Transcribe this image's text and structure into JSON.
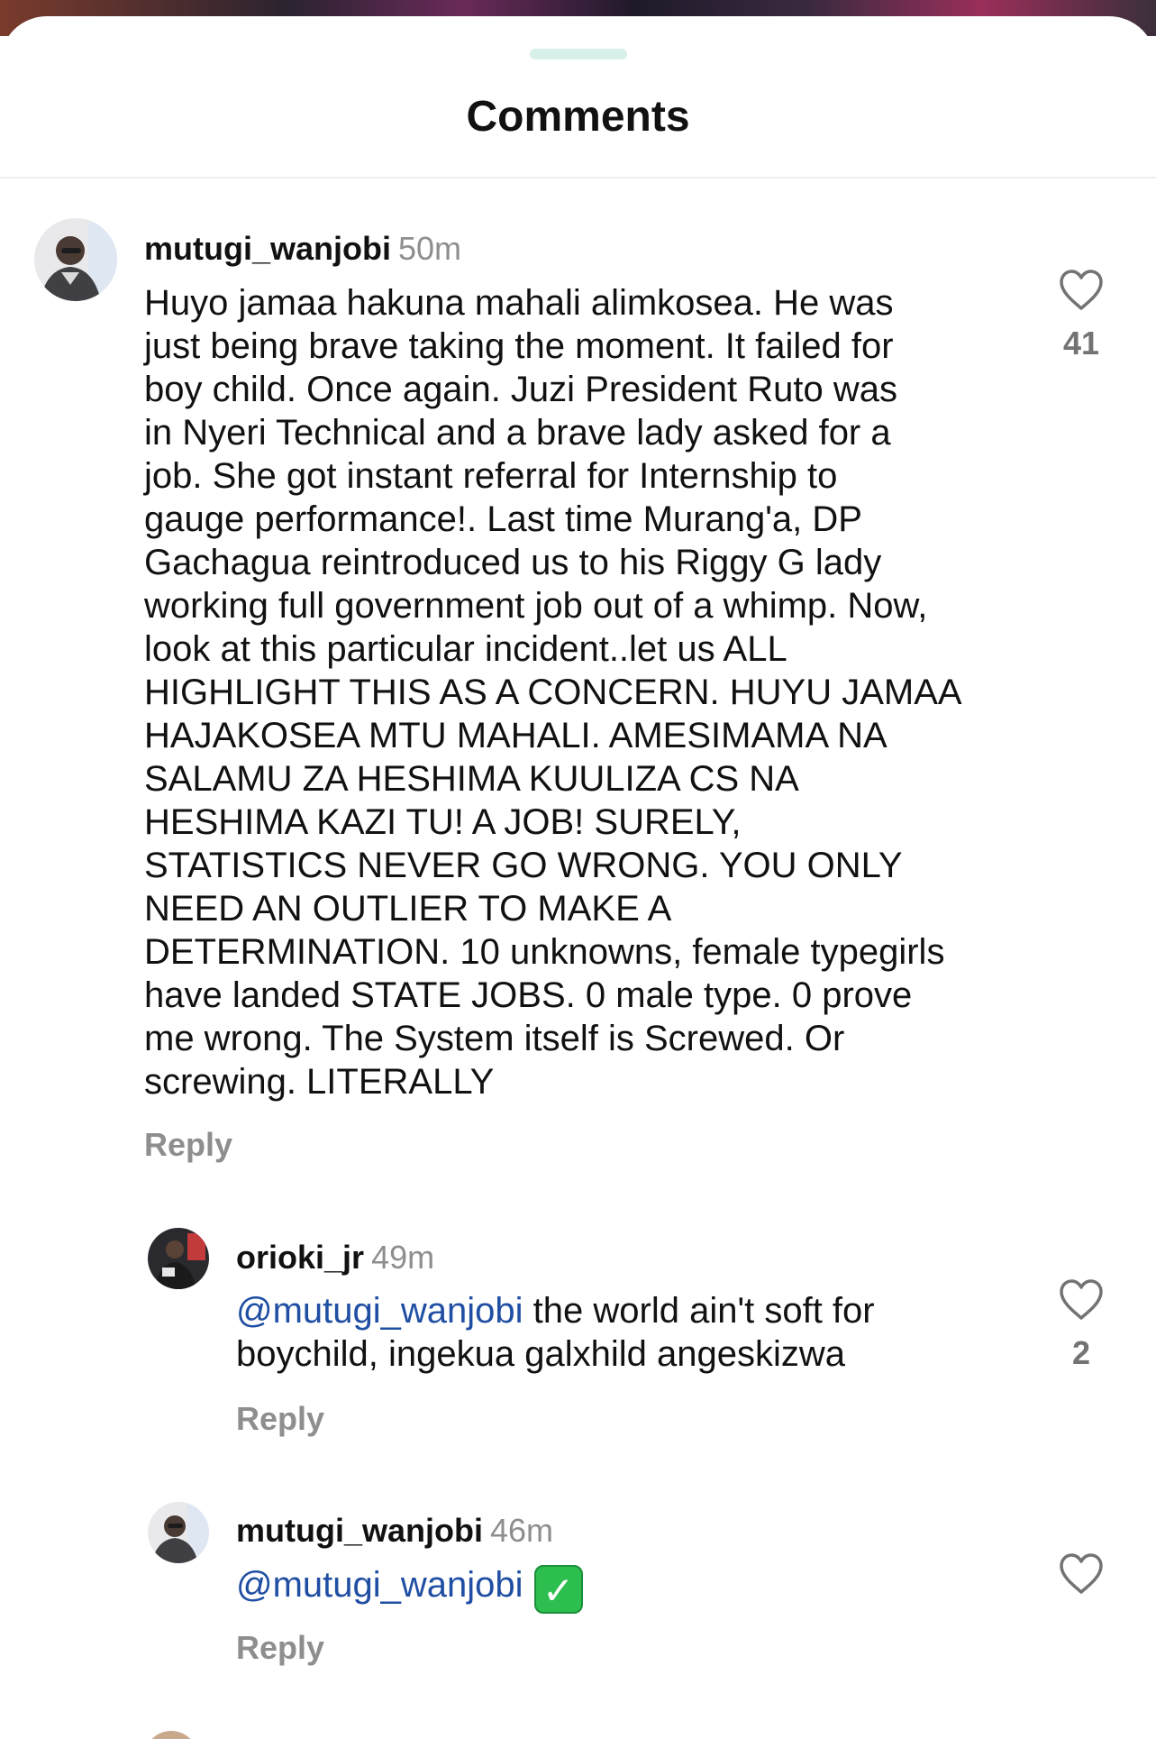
{
  "sheet": {
    "title": "Comments"
  },
  "comments": [
    {
      "username": "mutugi_wanjobi",
      "time": "50m",
      "text": "Huyo jamaa hakuna mahali alimkosea. He was\njust being brave taking the moment.  It failed for\nboy child. Once again.  Juzi President Ruto was\nin Nyeri Technical and a brave lady asked for a\njob. She got instant referral for Internship to\ngauge performance!. Last time Murang'a,  DP\nGachagua reintroduced us to his Riggy G lady\nworking full government job out of a whimp. Now,\nlook at this particular incident..let us ALL\nHIGHLIGHT THIS AS A CONCERN.  HUYU JAMAA\nHAJAKOSEA MTU MAHALI. AMESIMAMA NA\nSALAMU ZA HESHIMA KUULIZA CS NA\nHESHIMA KAZI TU!  A JOB!  SURELY,\nSTATISTICS NEVER GO WRONG.  YOU ONLY\nNEED AN OUTLIER TO MAKE A\nDETERMINATION.  10 unknowns, female typegirls\nhave landed STATE JOBS. 0 male type.  0 prove\nme wrong.  The System itself is Screwed.  Or\nscrewing. LITERALLY",
      "reply_label": "Reply",
      "likes": "41",
      "like_icon": "heart-outline-icon"
    },
    {
      "username": "orioki_jr",
      "time": "49m",
      "mention": "@mutugi_wanjobi",
      "text": " the world ain't soft for\nboychild, ingekua galxhild angeskizwa",
      "reply_label": "Reply",
      "likes": "2",
      "like_icon": "heart-outline-icon"
    },
    {
      "username": "mutugi_wanjobi",
      "time": "46m",
      "mention": "@mutugi_wanjobi",
      "emoji": "✓",
      "emoji_name": "check-mark-button-emoji",
      "reply_label": "Reply",
      "like_icon": "heart-outline-icon"
    }
  ],
  "colors": {
    "mention": "#1f4ea3",
    "muted": "#8e8e8e",
    "text": "#111111",
    "grabber": "#d8f0ea"
  }
}
